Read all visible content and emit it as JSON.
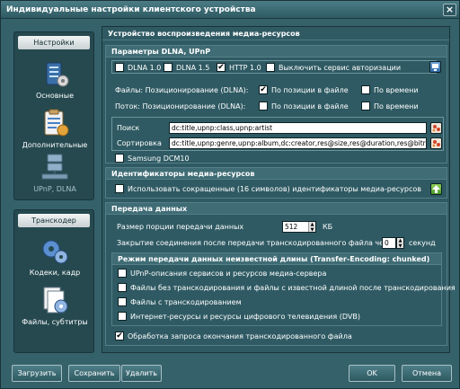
{
  "window": {
    "title": "Индивидуальные настройки клиентского устройства",
    "close": "×"
  },
  "sidebar": {
    "settings_header": "Настройки",
    "settings_items": [
      {
        "label": "Основные"
      },
      {
        "label": "Дополнительные"
      },
      {
        "label": "UPnP, DLNA"
      }
    ],
    "transcoder_header": "Транскодер",
    "transcoder_items": [
      {
        "label": "Кодеки, кадр"
      },
      {
        "label": "Файлы, субтитры"
      }
    ]
  },
  "main": {
    "title": "Устройство воспроизведения медиа-ресурсов",
    "dlna": {
      "header": "Параметры DLNA, UPnP",
      "options": [
        {
          "label": "DLNA 1.0",
          "checked": false
        },
        {
          "label": "DLNA 1.5",
          "checked": false
        },
        {
          "label": "HTTP 1.0",
          "checked": true
        },
        {
          "label": "Выключить сервис авторизации",
          "checked": false
        }
      ],
      "files_label": "Файлы: Позиционирование (DLNA):",
      "files_options": [
        {
          "label": "По позиции в файле",
          "checked": true
        },
        {
          "label": "По времени",
          "checked": false
        }
      ],
      "stream_label": "Поток: Позиционирование (DLNA):",
      "stream_options": [
        {
          "label": "По позиции в файле",
          "checked": false
        },
        {
          "label": "По времени",
          "checked": false
        }
      ],
      "search_label": "Поиск",
      "search_value": "dc:title,upnp:class,upnp:artist",
      "sort_label": "Сортировка",
      "sort_value": "dc:title,upnp:genre,upnp:album,dc:creator,res@size,res@duration,res@bitrate,dc:",
      "samsung": {
        "label": "Samsung DCM10",
        "checked": false
      }
    },
    "ids": {
      "header": "Идентификаторы медиа-ресурсов",
      "option": {
        "label": "Использовать сокращенные (16 символов) идентификаторы медиа-ресурсов",
        "checked": false
      }
    },
    "transfer": {
      "header": "Передача данных",
      "chunk_label": "Размер порции передачи данных",
      "chunk_value": "512",
      "chunk_unit": "КБ",
      "close_label": "Закрытие соединения после передачи транскодированного файла через",
      "close_value": "0",
      "close_unit": "секунд",
      "sub_header": "Режим передачи данных неизвестной длины (Transfer-Encoding: chunked)",
      "sub_options": [
        {
          "label": "UPnP-описания сервисов и ресурсов медиа-сервера",
          "checked": false
        },
        {
          "label": "Файлы без транскодирования и файлы с известной длиной после транскодирования",
          "checked": false
        },
        {
          "label": "Файлы с транскодированием",
          "checked": false
        },
        {
          "label": "Интернет-ресурсы и ресурсы цифрового телевидения (DVB)",
          "checked": false
        }
      ],
      "end_option": {
        "label": "Обработка запроса окончания транскодированного файла",
        "checked": true
      }
    }
  },
  "footer": {
    "load": "Загрузить",
    "save": "Сохранить",
    "delete": "Удалить",
    "ok": "OK",
    "cancel": "Отмена"
  },
  "check_mark": "✔"
}
